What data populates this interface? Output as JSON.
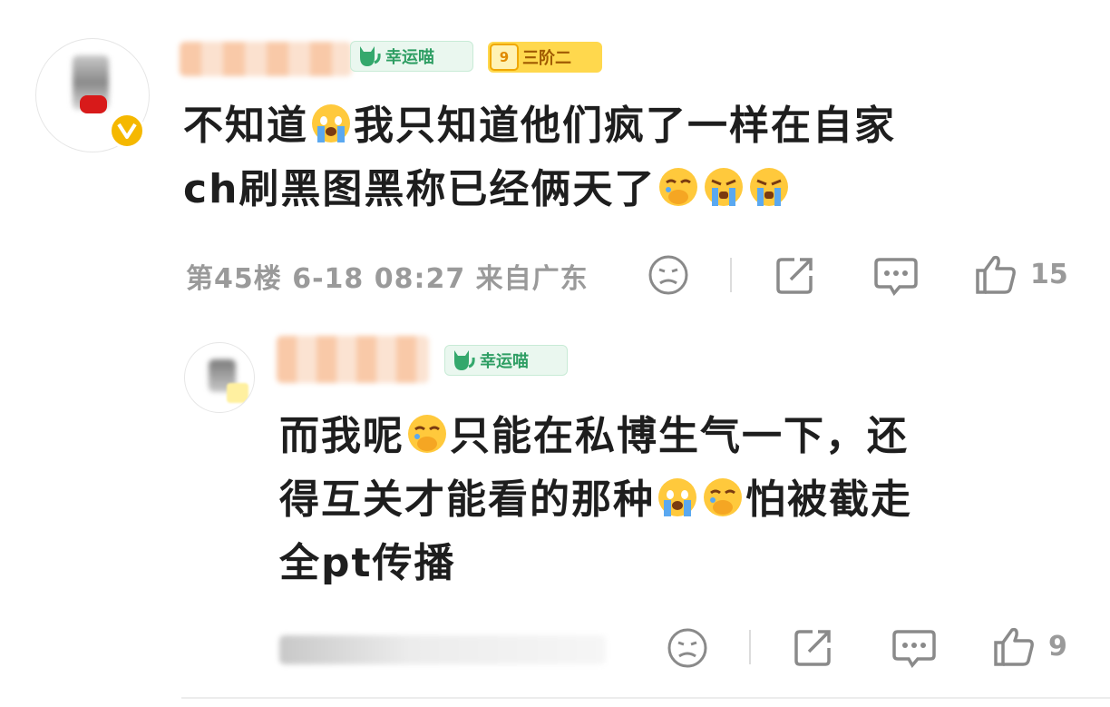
{
  "comment1": {
    "badge_lucky": "幸运喵",
    "level_num": "9",
    "level_text": "三阶二",
    "text_line1_a": "不知道",
    "text_line1_b": "我只知道他们疯了一样在自家",
    "text_line2": "ch刷黑图黑称已经俩天了",
    "meta": "第45楼 6-18 08:27 来自广东",
    "like_count": "15",
    "icons": [
      "sad-face-icon",
      "share-icon",
      "comment-icon",
      "thumbs-up-icon"
    ]
  },
  "reply1": {
    "badge_lucky": "幸运喵",
    "text_line1_a": "而我呢",
    "text_line1_b": "只能在私博生气一下，还",
    "text_line2_a": "得互关才能看的那种",
    "text_line2_b": "怕被截走",
    "text_line3": "全pt传播",
    "like_count": "9"
  },
  "colors": {
    "lucky_green": "#2e9e63",
    "level_yellow": "#ffd84d",
    "verified": "#f5b800",
    "meta_gray": "#9a9a9a"
  }
}
